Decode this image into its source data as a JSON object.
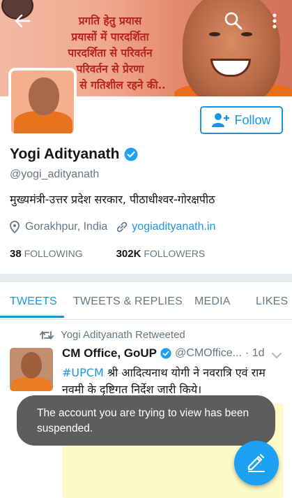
{
  "banner": {
    "lines": [
      "प्रगति हेतु प्रयास",
      "प्रयासों में पारदर्शिता",
      "पारदर्शिता से परिवर्तन",
      "परिवर्तन से प्रेरणा",
      "प्रेरणा से गतिशील रहने की.."
    ]
  },
  "follow_label": "Follow",
  "profile": {
    "name": "Yogi Adityanath",
    "handle": "@yogi_adityanath",
    "bio": "मुख्यमंत्री-उत्तर प्रदेश सरकार,  पीठाधीश्वर-गोरक्षपीठ",
    "location": "Gorakhpur, India",
    "website": "yogiadityanath.in",
    "following_count": "38",
    "following_label": "FOLLOWING",
    "followers_count": "302K",
    "followers_label": "FOLLOWERS"
  },
  "tabs": [
    {
      "label": "TWEETS",
      "active": true
    },
    {
      "label": "TWEETS & REPLIES",
      "active": false
    },
    {
      "label": "MEDIA",
      "active": false
    },
    {
      "label": "LIKES",
      "active": false
    }
  ],
  "tweet": {
    "retweet_note": "Yogi Adityanath Retweeted",
    "author": "CM Office, GoUP",
    "handle": "@CMOffice...",
    "time": "· 1d",
    "hashtag": "#UPCM",
    "text": " श्री आदित्यनाथ योगी ने नवरात्रि एवं राम नवमी के दृष्टिगत निर्देश जारी किये।"
  },
  "toast": {
    "message": "The account you are trying to view has been suspended."
  },
  "icons": {
    "back": "arrow-left-icon",
    "search": "search-icon",
    "more": "more-vertical-icon",
    "verified": "verified-badge-icon",
    "location": "location-pin-icon",
    "link": "link-icon",
    "retweet": "retweet-icon",
    "compose": "compose-icon",
    "add_user": "add-user-icon"
  },
  "colors": {
    "accent": "#1b95e0",
    "fab": "#1da1f2",
    "toast_bg": "#5d5d5d"
  }
}
